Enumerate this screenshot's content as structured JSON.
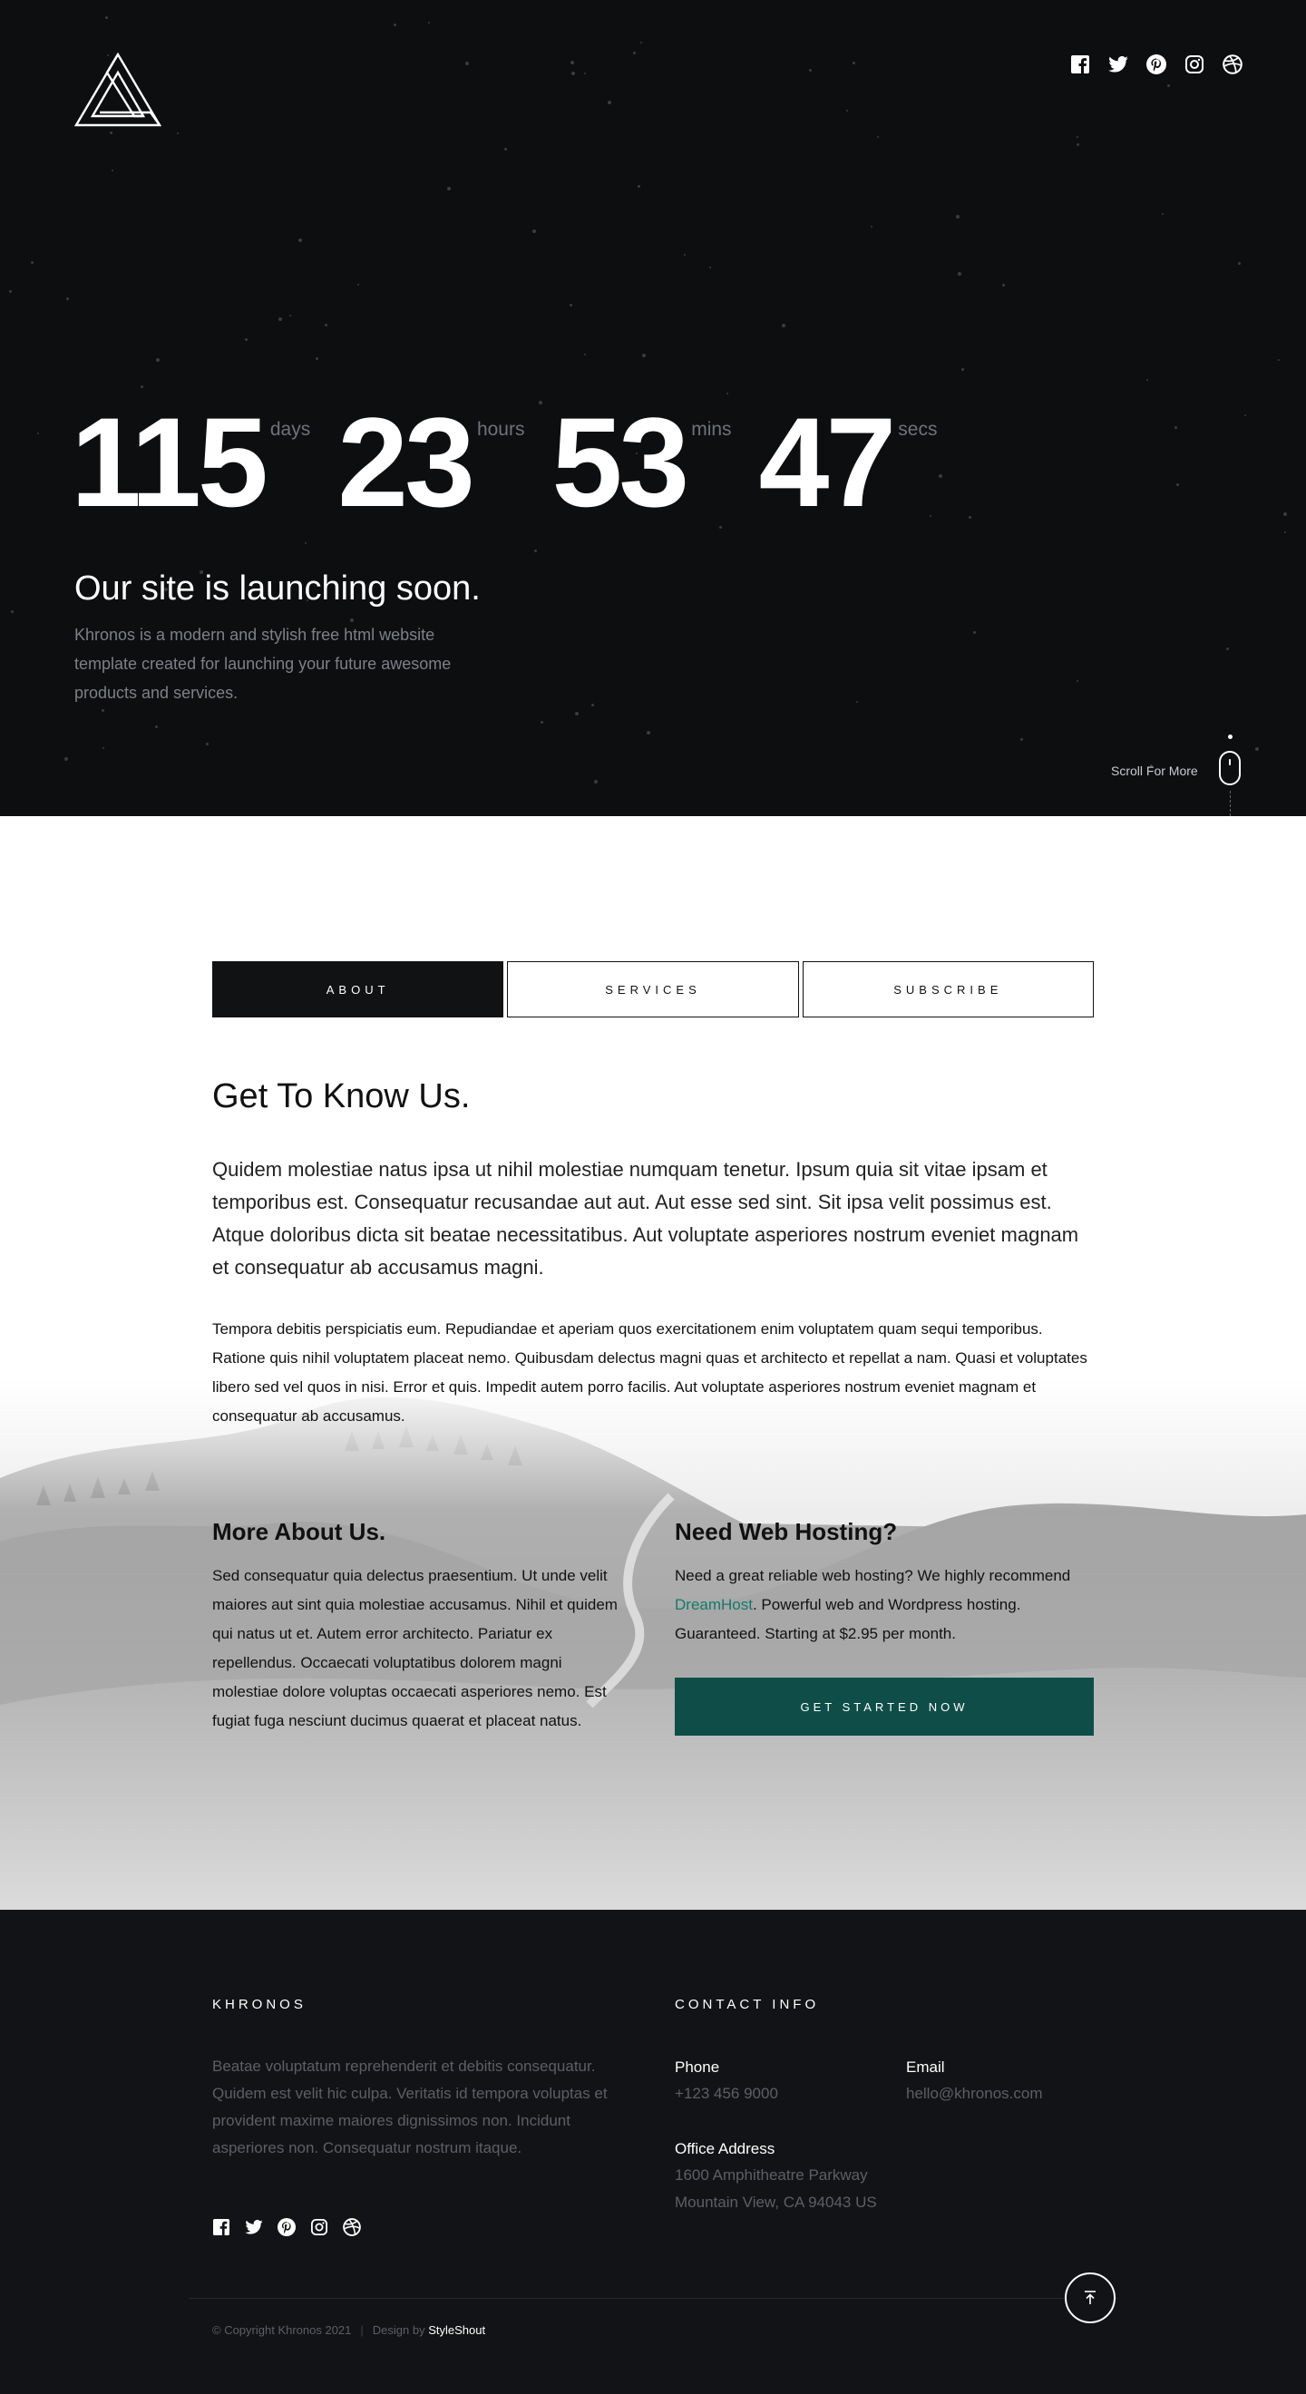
{
  "hero": {
    "countdown": [
      {
        "value": "115",
        "label": "days"
      },
      {
        "value": "23",
        "label": "hours"
      },
      {
        "value": "53",
        "label": "mins"
      },
      {
        "value": "47",
        "label": "secs"
      }
    ],
    "title": "Our site is launching soon.",
    "description": "Khronos is a modern and stylish free html website template created for launching your future awesome products and services.",
    "scroll_label": "Scroll For More",
    "social_icons": [
      "facebook-icon",
      "twitter-icon",
      "pinterest-icon",
      "instagram-icon",
      "dribbble-icon"
    ]
  },
  "tabs": [
    "ABOUT",
    "SERVICES",
    "SUBSCRIBE"
  ],
  "about": {
    "title": "Get To Know Us.",
    "lead": "Quidem molestiae natus ipsa ut nihil molestiae numquam tenetur. Ipsum quia sit vitae ipsam et temporibus est. Consequatur recusandae aut aut. Aut esse sed sint. Sit ipsa velit possimus est. Atque doloribus dicta sit beatae necessitatibus. Aut voluptate asperiores nostrum eveniet magnam et consequatur ab accusamus magni.",
    "body": "Tempora debitis perspiciatis eum. Repudiandae et aperiam quos exercitationem enim voluptatem quam sequi temporibus. Ratione quis nihil voluptatem placeat nemo. Quibusdam delectus magni quas et architecto et repellat a nam. Quasi et voluptates libero sed vel quos in nisi. Error et quis. Impedit autem porro facilis. Aut voluptate asperiores nostrum eveniet magnam et consequatur ab accusamus.",
    "more_title": "More About Us.",
    "more_text": "Sed consequatur quia delectus praesentium. Ut unde velit maiores aut sint quia molestiae accusamus. Nihil et quidem qui natus ut et. Autem error architecto. Pariatur ex repellendus. Occaecati voluptatibus dolorem magni molestiae dolore voluptas occaecati asperiores nemo. Est fugiat fuga nesciunt ducimus quaerat et placeat natus.",
    "hosting_title": "Need Web Hosting?",
    "hosting_text_before": "Need a great reliable web hosting? We highly recommend ",
    "hosting_link": "DreamHost",
    "hosting_text_after": ". Powerful web and Wordpress hosting. Guaranteed. Starting at $2.95 per month.",
    "cta": "GET STARTED NOW"
  },
  "footer": {
    "brand": "KHRONOS",
    "brand_text": "Beatae voluptatum reprehenderit et debitis consequatur. Quidem est velit hic culpa. Veritatis id tempora voluptas et provident maxime maiores dignissimos non. Incidunt asperiores non. Consequatur nostrum itaque.",
    "contact_heading": "CONTACT INFO",
    "phone_label": "Phone",
    "phone": "+123 456 9000",
    "email_label": "Email",
    "email": "hello@khronos.com",
    "address_label": "Office Address",
    "address_line1": "1600 Amphitheatre Parkway",
    "address_line2": "Mountain View, CA 94043 US",
    "copyright": "© Copyright Khronos 2021",
    "design_by": "Design by",
    "designer": "StyleShout",
    "colors": {
      "cta": "#0f4d48",
      "link": "#127a6b",
      "dark": "#0d0e10"
    }
  }
}
